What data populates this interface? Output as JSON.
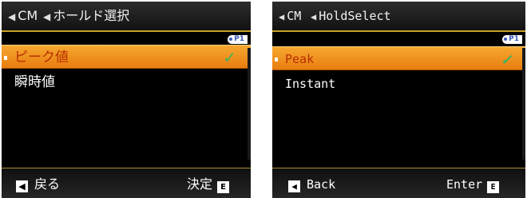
{
  "screens": [
    {
      "lang": "jp",
      "breadcrumb": {
        "parent": "CM",
        "current": "ホールド選択"
      },
      "page_indicator": "P1",
      "menu_items": [
        {
          "label": "ピーク値",
          "selected": true,
          "checked": true
        },
        {
          "label": "瞬時値",
          "selected": false,
          "checked": false
        }
      ],
      "softkeys": {
        "back": {
          "label": "戻る",
          "key": "◀"
        },
        "enter": {
          "label": "決定",
          "key": "E"
        }
      }
    },
    {
      "lang": "en",
      "breadcrumb": {
        "parent": "CM",
        "current": "HoldSelect"
      },
      "page_indicator": "P1",
      "menu_items": [
        {
          "label": "Peak",
          "selected": true,
          "checked": true
        },
        {
          "label": "Instant",
          "selected": false,
          "checked": false
        }
      ],
      "softkeys": {
        "back": {
          "label": "Back",
          "key": "◀"
        },
        "enter": {
          "label": "Enter",
          "key": "E"
        }
      }
    }
  ],
  "icons": {
    "checkmark": "check-icon",
    "back": "left-arrow-icon",
    "enter": "e-key-icon"
  },
  "colors": {
    "highlight": "#f09020",
    "highlight_text": "#b83000",
    "check": "#44b060",
    "accent_line": "#c9a227"
  }
}
